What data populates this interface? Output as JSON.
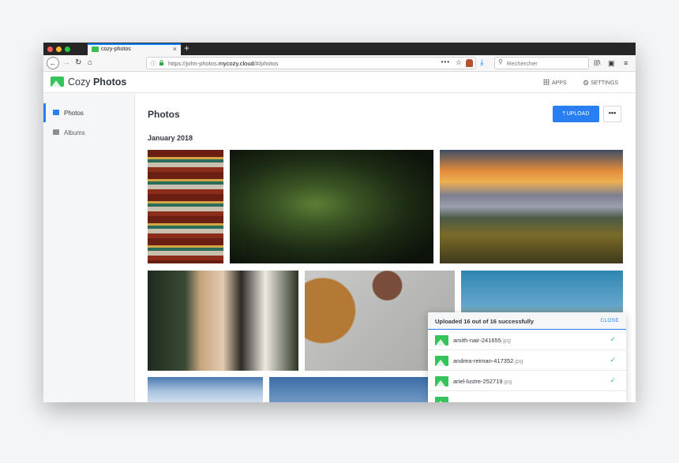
{
  "browser": {
    "tab_title": "cozy-photos",
    "url_prefix": "https://john-photos.",
    "url_domain": "mycozy.cloud",
    "url_suffix": "/#/photos",
    "search_placeholder": "Rechercher"
  },
  "app": {
    "brand_light": "Cozy",
    "brand_bold": "Photos",
    "apps_label": "APPS",
    "settings_label": "SETTINGS",
    "accent_color": "#297ef2"
  },
  "sidebar": {
    "items": [
      {
        "label": "Photos",
        "active": true
      },
      {
        "label": "Albums",
        "active": false
      }
    ]
  },
  "main": {
    "title": "Photos",
    "upload_label": "UPLOAD",
    "more_label": "•••",
    "month": "January 2018"
  },
  "upload_panel": {
    "title": "Uploaded 16 out of 16 successfully",
    "close_label": "CLOSE",
    "files": [
      {
        "name": "amith-nair-241655",
        "ext": ".jpg"
      },
      {
        "name": "andrea-reiman-417352",
        "ext": ".jpg"
      },
      {
        "name": "ariel-lustre-252719",
        "ext": ".jpg"
      }
    ]
  }
}
